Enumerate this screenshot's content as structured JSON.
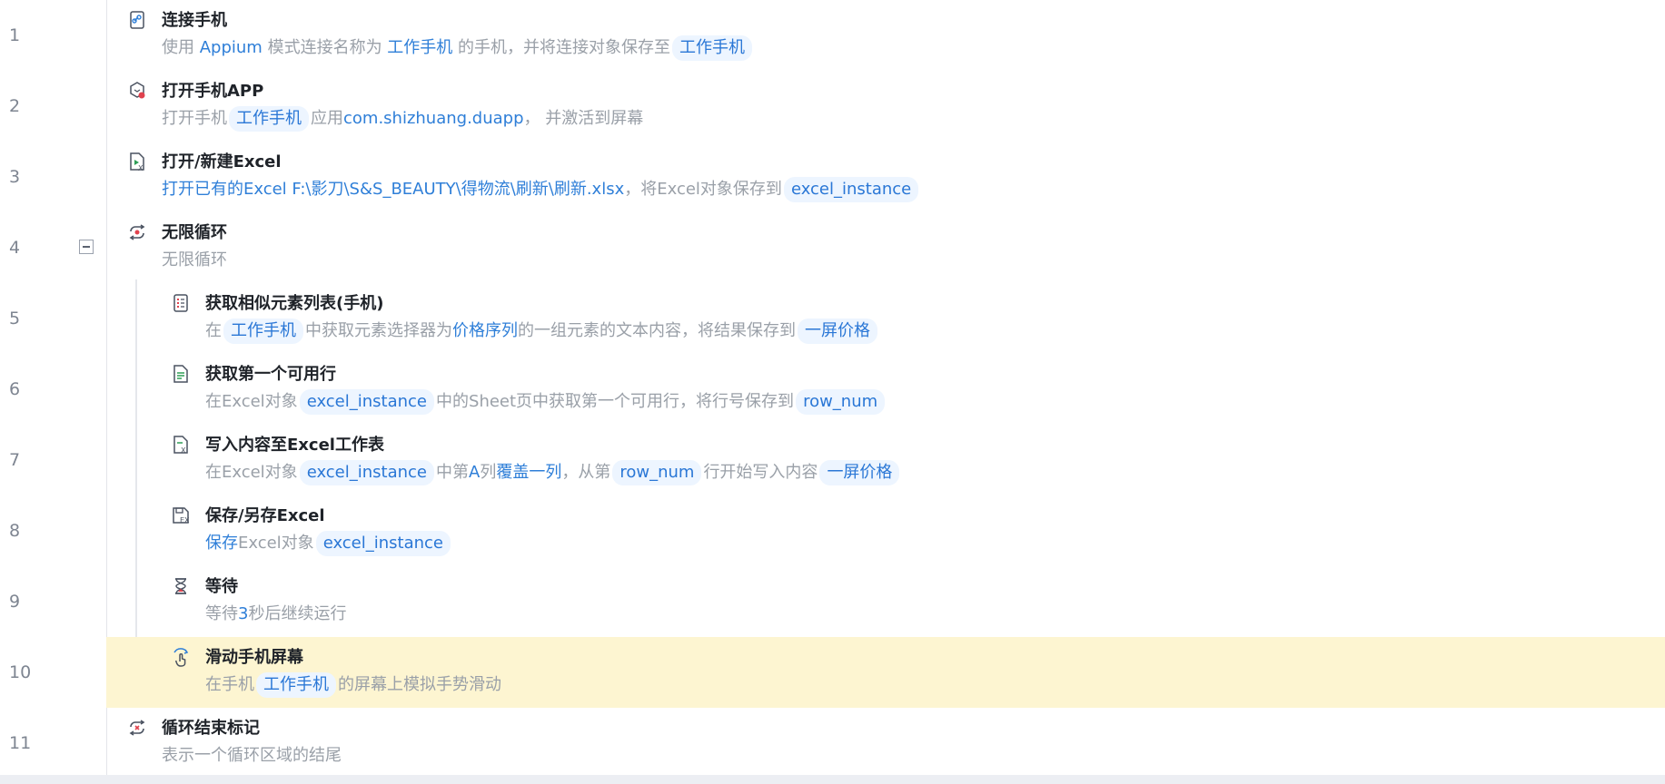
{
  "steps": [
    {
      "num": "1",
      "title": "连接手机",
      "icon": "link-phone-icon",
      "desc": [
        {
          "t": "使用 "
        },
        {
          "t": "Appium",
          "k": "v"
        },
        {
          "t": " 模式连接名称为 "
        },
        {
          "t": "工作手机",
          "k": "v"
        },
        {
          "t": " 的手机，并将连接对象保存至"
        },
        {
          "t": "工作手机",
          "k": "chip"
        }
      ]
    },
    {
      "num": "2",
      "title": "打开手机APP",
      "icon": "open-app-icon",
      "desc": [
        {
          "t": "打开手机"
        },
        {
          "t": "工作手机",
          "k": "chip"
        },
        {
          "t": "应用"
        },
        {
          "t": "com.shizhuang.duapp",
          "k": "v"
        },
        {
          "t": "，  并激活到屏幕"
        }
      ]
    },
    {
      "num": "3",
      "title": "打开/新建Excel",
      "icon": "excel-open-icon",
      "desc": [
        {
          "t": "打开已有的Excel F:\\影刀\\S&S_BEAUTY\\得物流\\刷新\\刷新.xlsx",
          "k": "v"
        },
        {
          "t": "，将Excel对象保存到"
        },
        {
          "t": "excel_instance",
          "k": "chip"
        }
      ]
    },
    {
      "num": "4",
      "title": "无限循环",
      "icon": "loop-icon",
      "collapse": true,
      "desc": [
        {
          "t": "无限循环"
        }
      ]
    },
    {
      "num": "5",
      "title": "获取相似元素列表(手机)",
      "icon": "element-list-icon",
      "desc": [
        {
          "t": "在"
        },
        {
          "t": "工作手机",
          "k": "chip"
        },
        {
          "t": "中获取元素选择器为"
        },
        {
          "t": "价格序列",
          "k": "v"
        },
        {
          "t": "的一组元素的文本内容，将结果保存到"
        },
        {
          "t": "一屏价格",
          "k": "chip"
        }
      ]
    },
    {
      "num": "6",
      "title": "获取第一个可用行",
      "icon": "excel-row-icon",
      "desc": [
        {
          "t": "在Excel对象"
        },
        {
          "t": "excel_instance",
          "k": "chip"
        },
        {
          "t": "中的Sheet页中获取第一个可用行，将行号保存到"
        },
        {
          "t": "row_num",
          "k": "chip"
        }
      ]
    },
    {
      "num": "7",
      "title": "写入内容至Excel工作表",
      "icon": "excel-write-icon",
      "desc": [
        {
          "t": "在Excel对象"
        },
        {
          "t": "excel_instance",
          "k": "chip"
        },
        {
          "t": "中第"
        },
        {
          "t": "A",
          "k": "v"
        },
        {
          "t": "列"
        },
        {
          "t": "覆盖一列",
          "k": "v"
        },
        {
          "t": "，从第"
        },
        {
          "t": "row_num",
          "k": "chip"
        },
        {
          "t": "行开始写入内容"
        },
        {
          "t": "一屏价格",
          "k": "chip"
        }
      ]
    },
    {
      "num": "8",
      "title": "保存/另存Excel",
      "icon": "excel-save-icon",
      "desc": [
        {
          "t": "保存",
          "k": "v"
        },
        {
          "t": "Excel对象"
        },
        {
          "t": "excel_instance",
          "k": "chip"
        }
      ]
    },
    {
      "num": "9",
      "title": "等待",
      "icon": "hourglass-icon",
      "desc": [
        {
          "t": "等待"
        },
        {
          "t": "3",
          "k": "v"
        },
        {
          "t": "秒后继续运行"
        }
      ]
    },
    {
      "num": "10",
      "title": "滑动手机屏幕",
      "icon": "swipe-icon",
      "highlight": true,
      "desc": [
        {
          "t": "在手机"
        },
        {
          "t": "工作手机",
          "k": "chip"
        },
        {
          "t": "的屏幕上模拟手势滑动"
        }
      ]
    },
    {
      "num": "11",
      "title": "循环结束标记",
      "icon": "loop-end-icon",
      "desc": [
        {
          "t": "表示一个循环区域的结尾"
        }
      ]
    }
  ]
}
